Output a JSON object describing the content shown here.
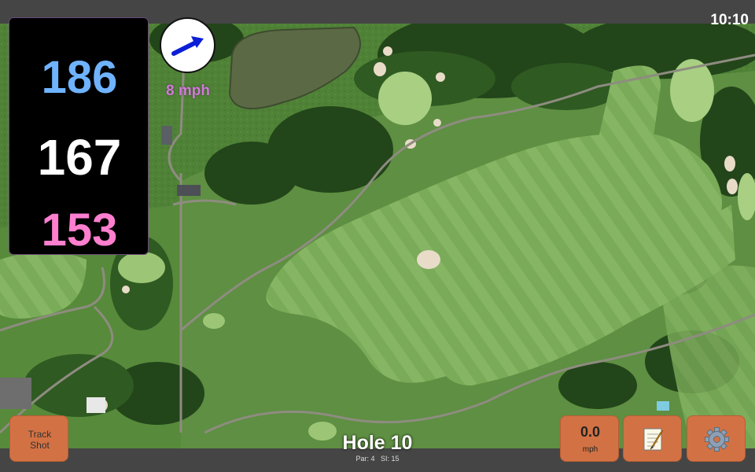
{
  "status_bar": {
    "time": "10:10"
  },
  "distances": {
    "back": "186",
    "center": "167",
    "front": "153"
  },
  "wind": {
    "speed": "8 mph",
    "direction_icon": "arrow-right-icon"
  },
  "hole": {
    "title": "Hole 10",
    "par": "Par: 4",
    "stroke_index": "SI: 15"
  },
  "buttons": {
    "track_shot": "Track\nShot",
    "speed_value": "0.0",
    "speed_unit": "mph",
    "notes_icon": "notepad-icon",
    "settings_icon": "gear-icon"
  },
  "colors": {
    "back_distance": "#6fb3ff",
    "center_distance": "#ffffff",
    "front_distance": "#ff7fcf",
    "button": "#d27244",
    "wind_text": "#d17bd6"
  }
}
